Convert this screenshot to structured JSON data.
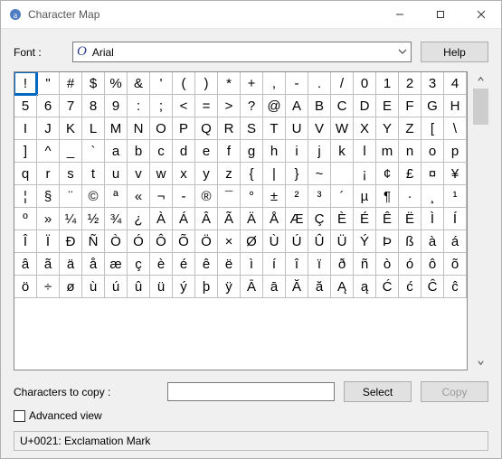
{
  "titlebar": {
    "title": "Character Map"
  },
  "labels": {
    "font": "Font :",
    "help": "Help",
    "chars_to_copy": "Characters to copy :",
    "select": "Select",
    "copy": "Copy",
    "advanced_view": "Advanced view"
  },
  "font": {
    "name": "Arial",
    "icon_glyph": "O"
  },
  "copy_input": {
    "value": "",
    "placeholder": ""
  },
  "advanced_checked": false,
  "status": "U+0021: Exclamation Mark",
  "selected_index": 0,
  "glyphs": [
    "!",
    "\"",
    "#",
    "$",
    "%",
    "&",
    "'",
    "(",
    ")",
    "*",
    "+",
    ",",
    "-",
    ".",
    "/",
    "0",
    "1",
    "2",
    "3",
    "4",
    "5",
    "6",
    "7",
    "8",
    "9",
    ":",
    ";",
    "<",
    "=",
    ">",
    "?",
    "@",
    "A",
    "B",
    "C",
    "D",
    "E",
    "F",
    "G",
    "H",
    "I",
    "J",
    "K",
    "L",
    "M",
    "N",
    "O",
    "P",
    "Q",
    "R",
    "S",
    "T",
    "U",
    "V",
    "W",
    "X",
    "Y",
    "Z",
    "[",
    "\\",
    "]",
    "^",
    "_",
    "`",
    "a",
    "b",
    "c",
    "d",
    "e",
    "f",
    "g",
    "h",
    "i",
    "j",
    "k",
    "l",
    "m",
    "n",
    "o",
    "p",
    "q",
    "r",
    "s",
    "t",
    "u",
    "v",
    "w",
    "x",
    "y",
    "z",
    "{",
    "|",
    "}",
    "~",
    " ",
    "¡",
    "¢",
    "£",
    "¤",
    "¥",
    "¦",
    "§",
    "¨",
    "©",
    "ª",
    "«",
    "¬",
    "-",
    "®",
    "¯",
    "°",
    "±",
    "²",
    "³",
    "´",
    "µ",
    "¶",
    "·",
    "¸",
    "¹",
    "º",
    "»",
    "¼",
    "½",
    "¾",
    "¿",
    "À",
    "Á",
    "Â",
    "Ã",
    "Ä",
    "Å",
    "Æ",
    "Ç",
    "È",
    "É",
    "Ê",
    "Ë",
    "Ì",
    "Í",
    "Î",
    "Ï",
    "Ð",
    "Ñ",
    "Ò",
    "Ó",
    "Ô",
    "Õ",
    "Ö",
    "×",
    "Ø",
    "Ù",
    "Ú",
    "Û",
    "Ü",
    "Ý",
    "Þ",
    "ß",
    "à",
    "á",
    "â",
    "ã",
    "ä",
    "å",
    "æ",
    "ç",
    "è",
    "é",
    "ê",
    "ë",
    "ì",
    "í",
    "î",
    "ï",
    "ð",
    "ñ",
    "ò",
    "ó",
    "ô",
    "õ",
    "ö",
    "÷",
    "ø",
    "ù",
    "ú",
    "û",
    "ü",
    "ý",
    "þ",
    "ÿ",
    "Ā",
    "ā",
    "Ă",
    "ă",
    "Ą",
    "ą",
    "Ć",
    "ć",
    "Ĉ",
    "ĉ"
  ]
}
